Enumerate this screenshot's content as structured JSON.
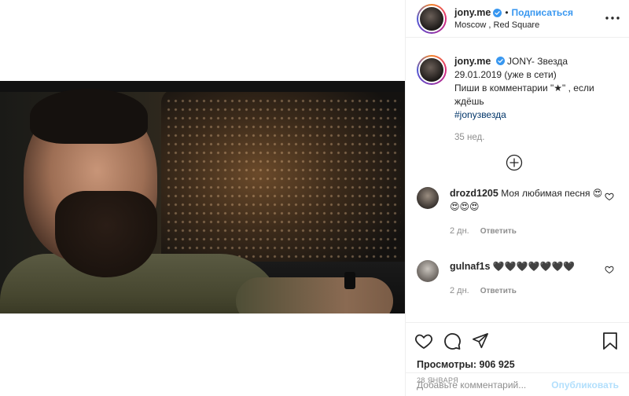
{
  "post": {
    "username": "jony.me",
    "follow_label": "Подписаться",
    "separator": "•",
    "location": "Moscow , Red Square"
  },
  "caption": {
    "username": "jony.me",
    "text_line1": "JONY- Звезда",
    "text_line2": "29.01.2019 (уже в сети)",
    "text_line3": "Пиши в комментарии \"★\" , если ждёшь",
    "hashtag": "#jonyзвезда",
    "age": "35 нед."
  },
  "comments": [
    {
      "username": "drozd1205",
      "text": "Моя любимая песня 😍😍😍😍",
      "age": "2 дн.",
      "reply_label": "Ответить"
    },
    {
      "username": "gulnaf1s",
      "text": "🖤🖤🖤🖤🖤🖤🖤",
      "age": "2 дн.",
      "reply_label": "Ответить"
    }
  ],
  "stats": {
    "views_label": "Просмотры:",
    "views_value": "906 925",
    "date": "28 ЯНВАРЯ"
  },
  "add_comment": {
    "placeholder": "Добавьте комментарий...",
    "publish_label": "Опубликовать"
  },
  "colors": {
    "accent": "#3897f0",
    "hashtag": "#003569",
    "muted": "#8e8e8e",
    "publish_disabled": "#b2dffc"
  },
  "icons": {
    "verified": "verified-badge-icon",
    "more": "more-options-icon",
    "load_more": "plus-circle-icon",
    "like": "heart-icon",
    "comment": "speech-bubble-icon",
    "share": "paper-plane-icon",
    "save": "bookmark-icon"
  }
}
